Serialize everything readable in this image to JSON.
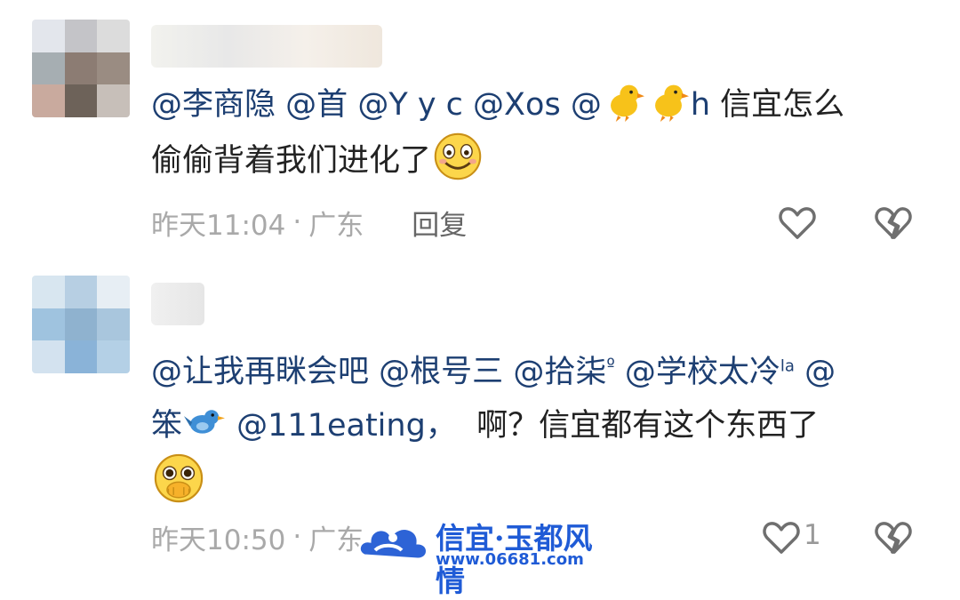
{
  "comments": [
    {
      "line1": [
        "@李商隐",
        "@首",
        "@Y y c",
        "@Xos",
        "@",
        "h",
        "信宜怎么"
      ],
      "line2": "偷偷背着我们进化了",
      "time": "昨天11:04",
      "dot": "·",
      "location": "广东",
      "reply_label": "回复"
    },
    {
      "line1": [
        "@让我再眯会吧",
        "@根号三",
        "@拾柒",
        "º",
        "@学校太冷",
        "la",
        "@"
      ],
      "line2_mention1": "笨",
      "line2_mention2": "@111eating，",
      "line2_text": "啊？信宜都有这个东西了",
      "time": "昨天10:50",
      "dot": "·",
      "location": "广东",
      "like_count": "1"
    }
  ],
  "watermark": {
    "title": "信宜·玉都风情",
    "url": "www.06681.com"
  },
  "colors": {
    "mention": "#1d3f72",
    "meta": "#a9a9a9",
    "icon": "#7a7a7a"
  }
}
